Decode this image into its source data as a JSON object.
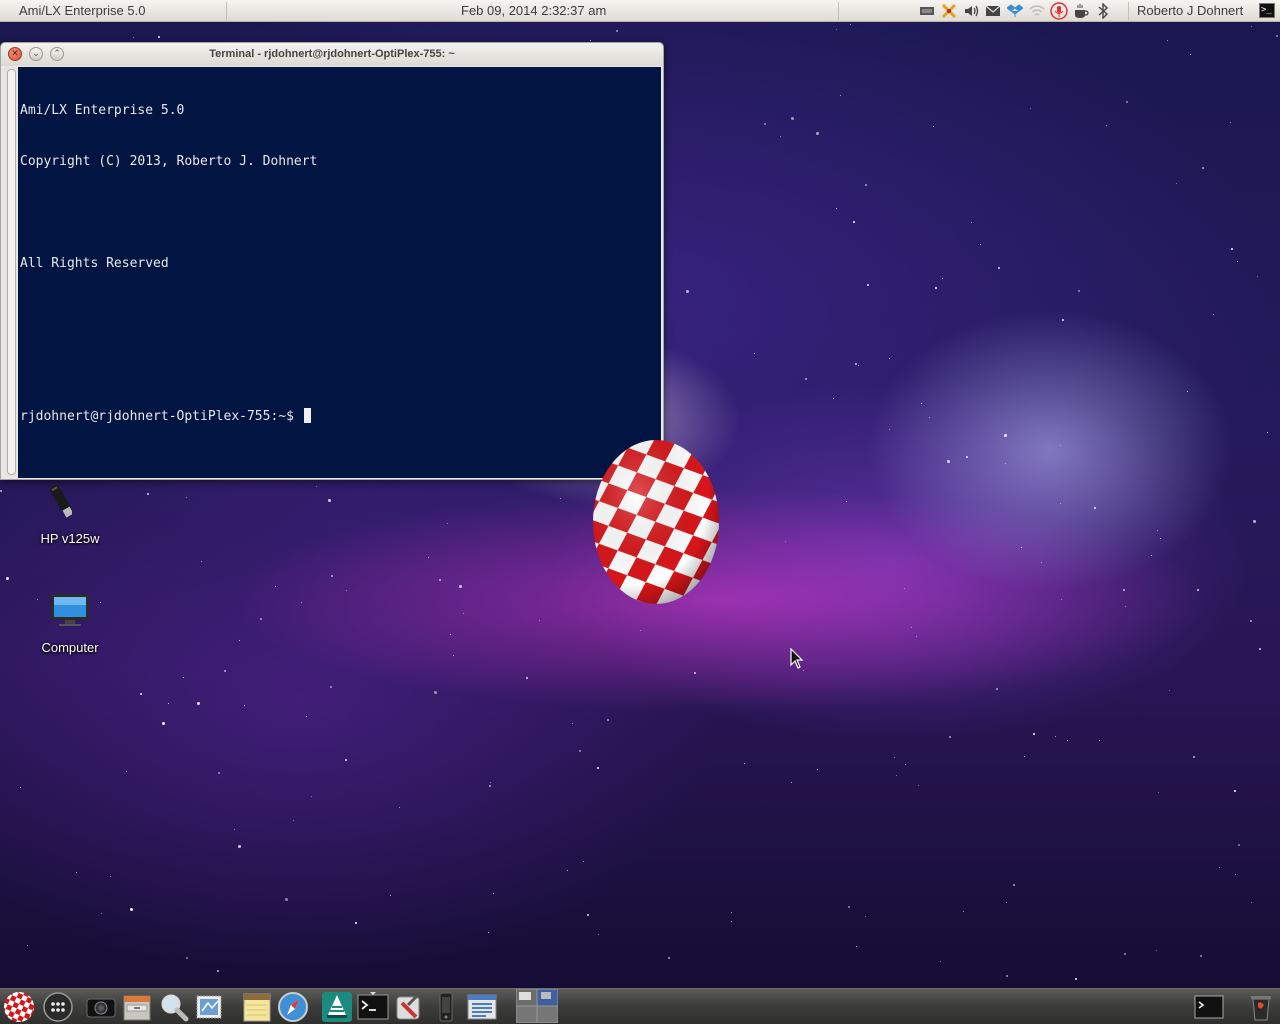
{
  "top_panel": {
    "app_title": "Ami/LX Enterprise 5.0",
    "clock": "Feb 09, 2014  2:32:37 am",
    "user_name": "Roberto J Dohnert",
    "tray_icons": [
      "network-icon",
      "tools-icon",
      "volume-icon",
      "mail-icon",
      "dropbox-icon",
      "wifi-icon",
      "microphone-icon",
      "coffee-icon",
      "bluetooth-icon"
    ],
    "panel_terminal_glyph": ">_"
  },
  "terminal": {
    "title": "Terminal - rjdohnert@rjdohnert-OptiPlex-755: ~",
    "close_glyph": "✕",
    "min_glyph": "⌄",
    "max_glyph": "⌃",
    "lines": [
      "Ami/LX Enterprise 5.0",
      "Copyright (C) 2013, Roberto J. Dohnert",
      "",
      "All Rights Reserved",
      "",
      ""
    ],
    "prompt": "rjdohnert@rjdohnert-OptiPlex-755:~$ ",
    "background_color": "#011442"
  },
  "desktop_icons": [
    {
      "label": "HP v125w",
      "icon": "usb-drive-icon"
    },
    {
      "label": "Computer",
      "icon": "computer-icon"
    }
  ],
  "dock": {
    "items": [
      "boing-ball-icon",
      "app-grid-icon",
      "camera-icon",
      "file-cabinet-icon",
      "search-icon",
      "mail-stamp-icon",
      "notes-icon",
      "safari-icon",
      "vlc-icon",
      "terminal-icon",
      "system-prefs-icon",
      "phone-icon",
      "task-manager-icon",
      "workspace-switcher-icon"
    ],
    "right_items": [
      "terminal-window-icon",
      "trash-icon"
    ]
  },
  "colors": {
    "panel_bg": "#e6e3dd",
    "terminal_bg": "#011442",
    "dock_bg": "#3c3c3a"
  }
}
